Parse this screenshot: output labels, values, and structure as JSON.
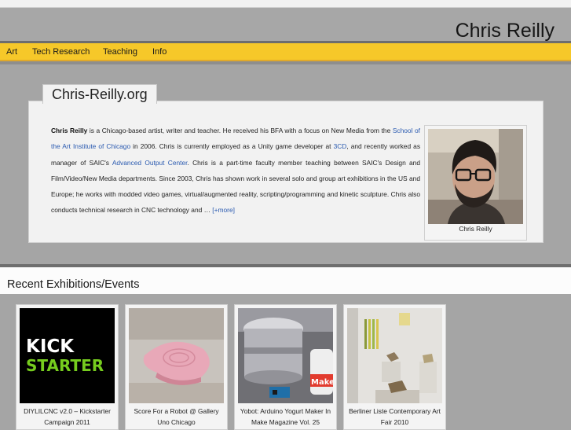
{
  "site": {
    "title": "Chris Reilly"
  },
  "nav": {
    "items": [
      "Art",
      "Tech Research",
      "Teaching",
      "Info"
    ]
  },
  "about": {
    "tab_title": "Chris-Reilly.org",
    "name": "Chris Reilly",
    "t1": " is a Chicago-based artist, writer and teacher. He received his BFA with a focus on New Media from the ",
    "link_saic": "School of the Art Institute of Chicago",
    "t2": " in 2006. Chris is currently employed as a Unity game developer at ",
    "link_3cd": "3CD",
    "t3": ", and recently worked as manager of SAIC's ",
    "link_aoc": "Advanced Output Center",
    "t4": ". Chris is a part-time faculty member teaching between SAIC's Design and Film/Video/New Media departments. Since 2003, Chris has shown work in several solo and group art exhibitions in the US and Europe; he works with modded video games, virtual/augmented reality, scripting/programming and kinetic sculpture. Chris also conducts technical research in CNC technology and … ",
    "more": "[+more]",
    "photo_caption": "Chris Reilly"
  },
  "events": {
    "title": "Recent Exhibitions/Events",
    "items": [
      {
        "caption": "DIYLILCNC v2.0 – Kickstarter Campaign 2011",
        "logo_line1": "KICK",
        "logo_line2": "STARTER"
      },
      {
        "caption": "Score For a Robot @ Gallery Uno Chicago"
      },
      {
        "caption": "Yobot: Arduino Yogurt Maker In Make Magazine Vol. 25",
        "label_text": "Make"
      },
      {
        "caption": "Berliner Liste Contemporary Art Fair 2010"
      }
    ]
  },
  "colors": {
    "nav_yellow": "#f6c829",
    "link_blue": "#2a5ab0",
    "kickstarter_green": "#76cc1e"
  }
}
